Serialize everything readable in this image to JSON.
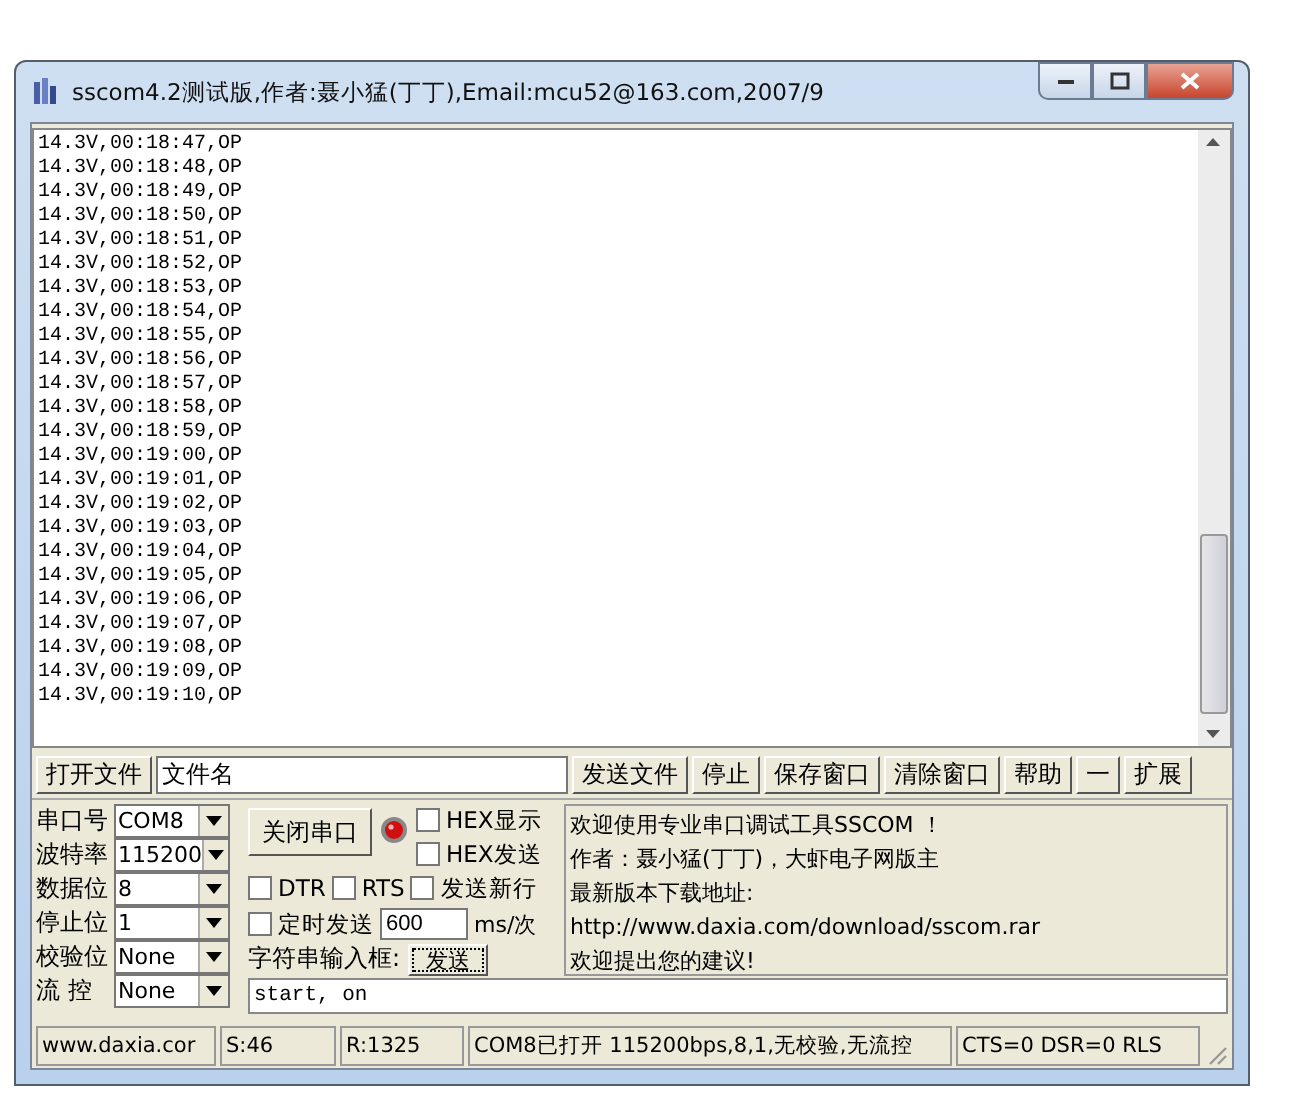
{
  "window": {
    "title": "sscom4.2测试版,作者:聂小猛(丁丁),Email:mcu52@163.com,2007/9"
  },
  "log": {
    "lines": [
      "14.3V,00:18:47,OP",
      "14.3V,00:18:48,OP",
      "14.3V,00:18:49,OP",
      "14.3V,00:18:50,OP",
      "14.3V,00:18:51,OP",
      "14.3V,00:18:52,OP",
      "14.3V,00:18:53,OP",
      "14.3V,00:18:54,OP",
      "14.3V,00:18:55,OP",
      "14.3V,00:18:56,OP",
      "14.3V,00:18:57,OP",
      "14.3V,00:18:58,OP",
      "14.3V,00:18:59,OP",
      "14.3V,00:19:00,OP",
      "14.3V,00:19:01,OP",
      "14.3V,00:19:02,OP",
      "14.3V,00:19:03,OP",
      "14.3V,00:19:04,OP",
      "14.3V,00:19:05,OP",
      "14.3V,00:19:06,OP",
      "14.3V,00:19:07,OP",
      "14.3V,00:19:08,OP",
      "14.3V,00:19:09,OP",
      "14.3V,00:19:10,OP"
    ]
  },
  "toolbar": {
    "open_file": "打开文件",
    "filename": "文件名",
    "buttons": [
      "发送文件",
      "停止",
      "保存窗口",
      "清除窗口",
      "帮助",
      "一",
      "扩展"
    ]
  },
  "settings": [
    {
      "label": "串口号",
      "value": "COM8"
    },
    {
      "label": "波特率",
      "value": "115200"
    },
    {
      "label": "数据位",
      "value": "8"
    },
    {
      "label": "停止位",
      "value": "1"
    },
    {
      "label": "校验位",
      "value": "None"
    },
    {
      "label": "流 控",
      "value": "None"
    }
  ],
  "close_port_button": "关闭串口",
  "hex_options": [
    {
      "label": "HEX显示",
      "checked": false
    },
    {
      "label": "HEX发送",
      "checked": false
    }
  ],
  "line_options": [
    {
      "label": "DTR",
      "checked": false
    },
    {
      "label": "RTS",
      "checked": false
    },
    {
      "label": "发送新行",
      "checked": false
    }
  ],
  "timer": {
    "label": "定时发送",
    "checked": false,
    "interval": "600",
    "unit": "ms/次"
  },
  "input_label": "字符串输入框:",
  "send_button": "发送",
  "input_value": "start, on",
  "info_lines": [
    "欢迎使用专业串口调试工具SSCOM ！",
    "作者：聂小猛(丁丁)，大虾电子网版主",
    "最新版本下载地址:",
    "http://www.daxia.com/download/sscom.rar",
    "欢迎提出您的建议!"
  ],
  "status_bar": [
    "www.daxia.cor",
    "S:46",
    "R:1325",
    "COM8已打开  115200bps,8,1,无校验,无流控",
    "CTS=0 DSR=0 RLS"
  ]
}
